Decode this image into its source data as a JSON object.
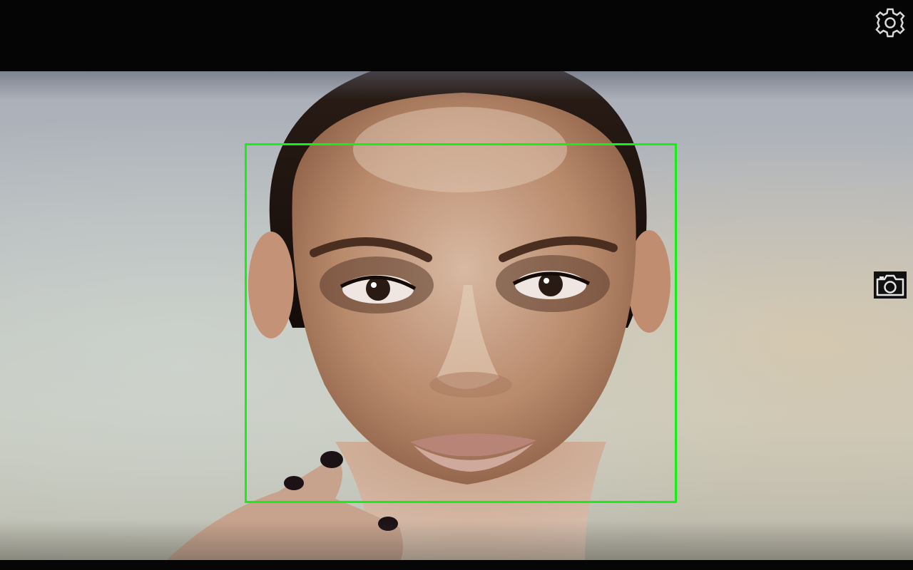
{
  "app": {
    "screen": "camera-face-detection"
  },
  "detection": {
    "faces_detected": 1,
    "box_color": "#14f014"
  },
  "controls": {
    "settings_icon": "gear-icon",
    "capture_icon": "camera-icon"
  },
  "colors": {
    "background": "#050505",
    "icon": "#d8d8d8"
  }
}
